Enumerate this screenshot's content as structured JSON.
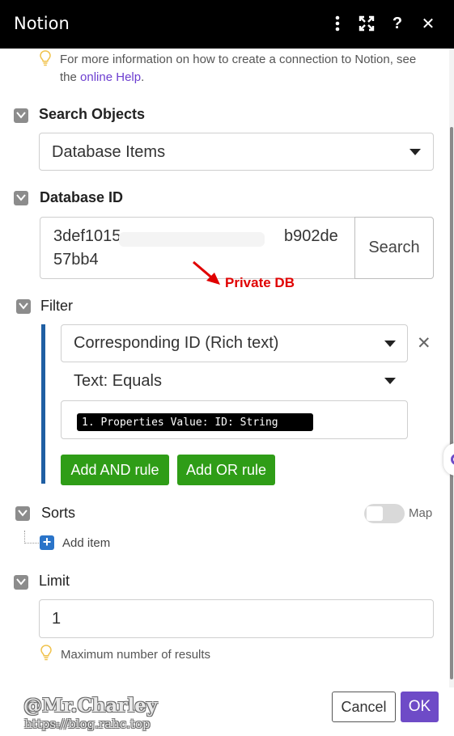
{
  "window": {
    "title": "Notion",
    "icons": [
      "more-vertical-icon",
      "expand-icon",
      "help-icon",
      "close-icon"
    ],
    "help_glyph": "?",
    "close_glyph": "✕",
    "more_glyph": "⋮",
    "expand_glyph": "⤧"
  },
  "connection_hint": {
    "text_before": "For more information on how to create a connection to Notion, see the ",
    "link": "online Help",
    "text_after": "."
  },
  "search_objects": {
    "label": "Search Objects",
    "value": "Database Items"
  },
  "database_id": {
    "label": "Database ID",
    "line1_start": "3def1015",
    "line1_end": "b902de",
    "line2": "57bb4",
    "search_button": "Search",
    "annotation": "Private DB"
  },
  "filter": {
    "label": "Filter",
    "field_value": "Corresponding ID (Rich text)",
    "operator_value": "Text: Equals",
    "chip_value": "1. Properties Value: ID: String",
    "remove_glyph": "✕",
    "add_and": "Add AND rule",
    "add_or": "Add OR rule"
  },
  "sorts": {
    "label": "Sorts",
    "map_label": "Map",
    "map_enabled": false,
    "add_item": "Add item",
    "plus_glyph": "+"
  },
  "limit": {
    "label": "Limit",
    "value": "1",
    "hint": "Maximum number of results"
  },
  "footer": {
    "cancel": "Cancel",
    "ok": "OK",
    "watermark_name": "@Mr.Charley",
    "watermark_url": "https://blog.rahc.top"
  },
  "colors": {
    "titlebar": "#000000",
    "ok_button": "#6e4bc7",
    "green_button": "#2f9d17",
    "filter_bar": "#1f5fa3",
    "link": "#6d3fd0",
    "annotation": "#e00000"
  }
}
